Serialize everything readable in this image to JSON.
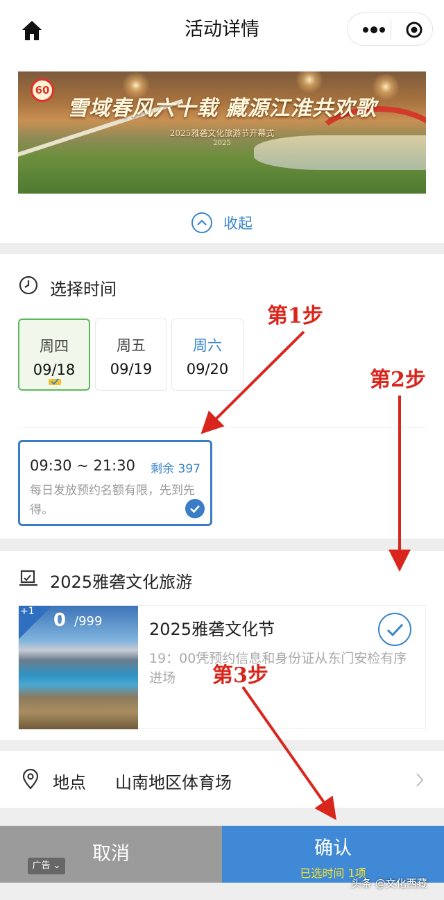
{
  "nav": {
    "title": "活动详情"
  },
  "banner": {
    "title": "雪域春风六十载 藏源江淮共欢歌",
    "subtitle": "2025雅砻文化旅游节开幕式",
    "subtitle2": "2025",
    "logo_text": "60",
    "collapse_label": "收起"
  },
  "time_section": {
    "title": "选择时间",
    "dates": [
      {
        "weekday": "周四",
        "date": "09/18",
        "selected": true
      },
      {
        "weekday": "周五",
        "date": "09/19",
        "selected": false
      },
      {
        "weekday": "周六",
        "date": "09/20",
        "selected": false
      }
    ],
    "slot": {
      "time": "09:30 ~ 21:30",
      "remaining": "剩余 397",
      "desc": "每日发放预约名额有限，先到先得。"
    }
  },
  "event_section": {
    "title": "2025雅砻文化旅游",
    "item": {
      "plus": "+1",
      "count": "0",
      "total": "/999",
      "name": "2025雅砻文化节",
      "desc": "19：00凭预约信息和身份证从东门安检有序进场"
    }
  },
  "location": {
    "label": "地点",
    "value": "山南地区体育场"
  },
  "bottom": {
    "cancel": "取消",
    "confirm": "确认",
    "confirm_sub": "已选时间 1项",
    "ad_tag": "广告"
  },
  "annotations": {
    "step1": "第1步",
    "step2": "第2步",
    "step3": "第3步"
  },
  "watermark": "头条 @文化西藏",
  "colors": {
    "accent_blue": "#3a86c9",
    "confirm_bg": "#4089d6",
    "cancel_bg": "#9b9b9b",
    "selected_green": "#5cb85c",
    "annotation_red": "#d9261c",
    "confirm_sub_yellow": "#f4e12f"
  }
}
